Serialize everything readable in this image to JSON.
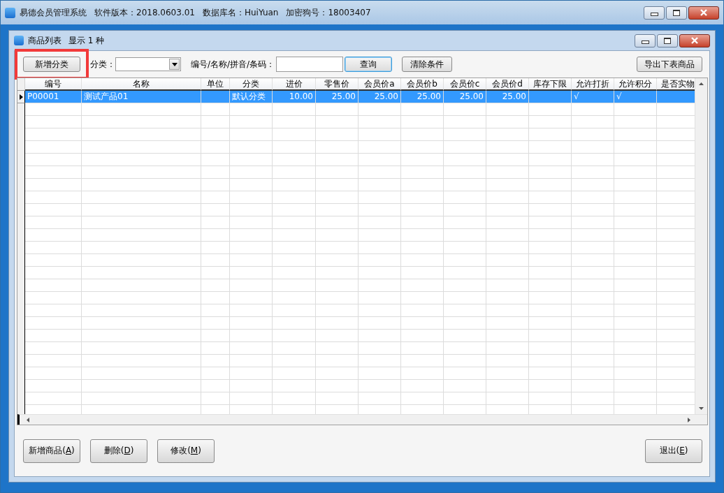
{
  "window": {
    "title_parts": [
      "易德会员管理系统",
      "软件版本：2018.0603.01",
      "数据库名：HuiYuan",
      "加密狗号：18003407"
    ]
  },
  "child_window": {
    "title": "商品列表",
    "count_text": "显示 1 种"
  },
  "toolbar": {
    "add_category_button": {
      "label": "新增分类",
      "highlighted": true
    },
    "category_label": "分类：",
    "search_label": "编号/名称/拼音/条码：",
    "query_button": "查询",
    "clear_button": "清除条件",
    "export_button": "导出下表商品"
  },
  "table": {
    "columns": [
      "编号",
      "名称",
      "单位",
      "分类",
      "进价",
      "零售价",
      "会员价a",
      "会员价b",
      "会员价c",
      "会员价d",
      "库存下限",
      "允许打折",
      "允许积分",
      "是否实物"
    ],
    "rows": [
      {
        "selected": true,
        "cells": [
          "P00001",
          "测试产品01",
          null,
          "默认分类",
          "10.00",
          "25.00",
          "25.00",
          "25.00",
          "25.00",
          "25.00",
          null,
          "√",
          "√",
          null
        ]
      }
    ]
  },
  "bottom_buttons": [
    {
      "before": "新增商品(",
      "key": "A",
      "after": ")"
    },
    {
      "before": "删除(",
      "key": "D",
      "after": ")"
    },
    {
      "before": "修改(",
      "key": "M",
      "after": ")"
    }
  ],
  "exit_button": {
    "before": "退出(",
    "key": "E",
    "after": ")"
  }
}
